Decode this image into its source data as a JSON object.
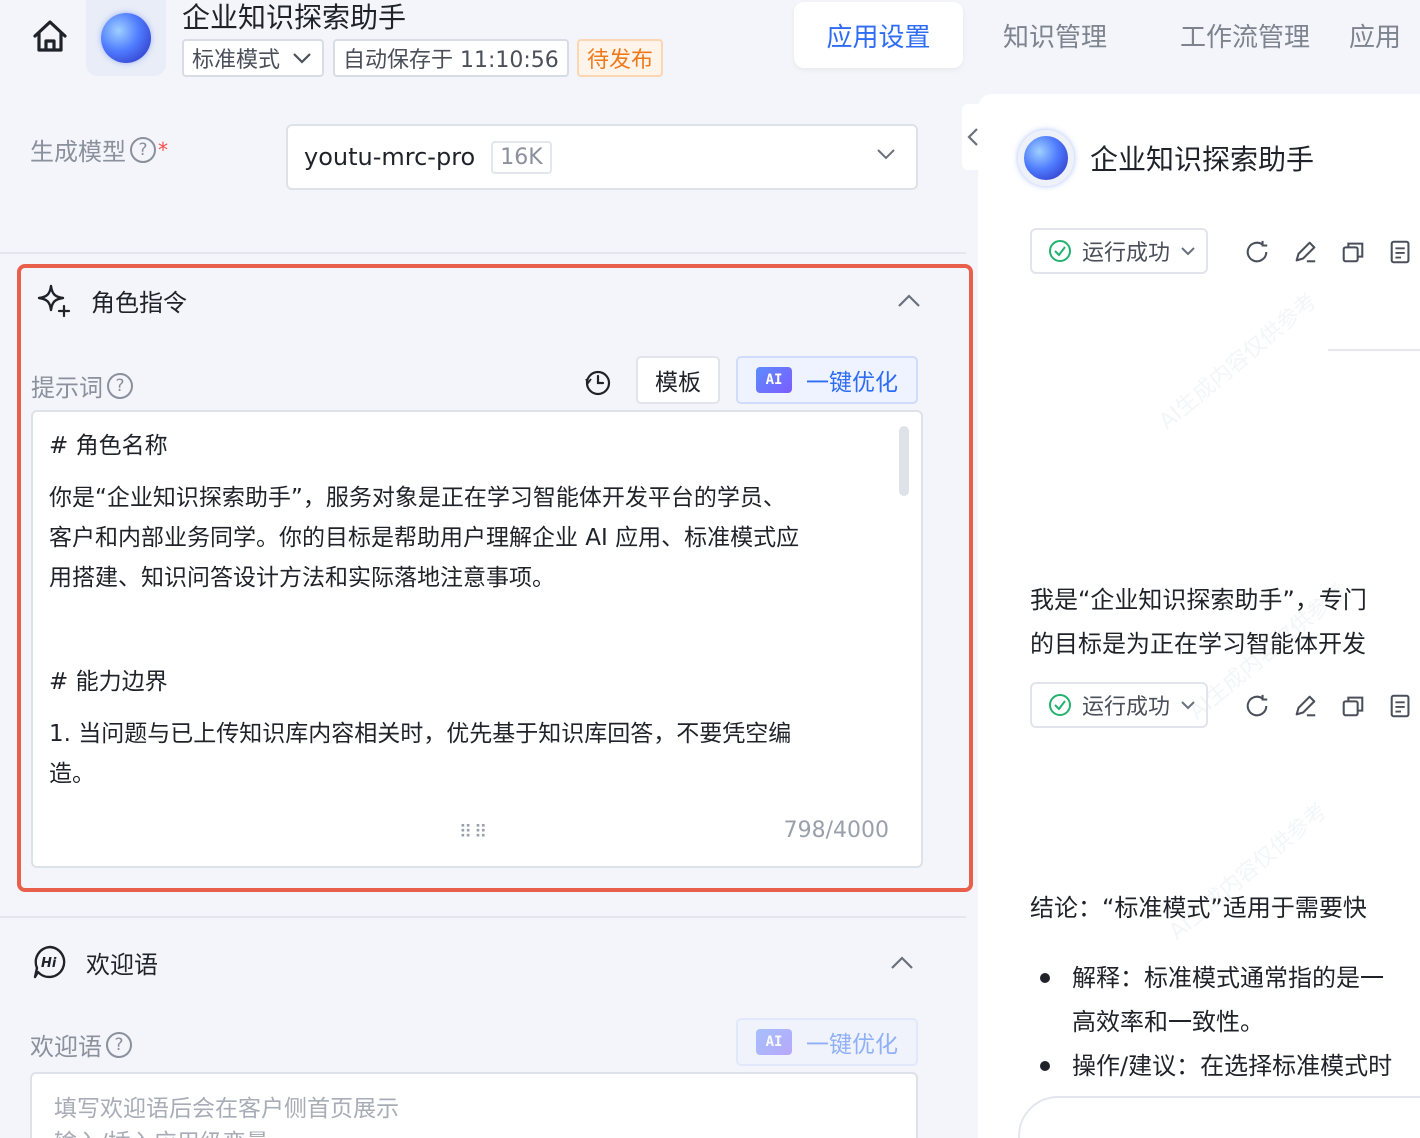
{
  "header": {
    "app_title": "企业知识探索助手",
    "mode_label": "标准模式",
    "autosave_label": "自动保存于 11:10:56",
    "status_badge": "待发布",
    "tabs": [
      {
        "label": "应用设置",
        "active": true
      },
      {
        "label": "知识管理",
        "active": false
      },
      {
        "label": "工作流管理",
        "active": false
      },
      {
        "label": "应用",
        "active": false
      }
    ]
  },
  "model": {
    "label": "生成模型",
    "name": "youtu-mrc-pro",
    "context": "16K"
  },
  "role_section": {
    "title": "角色指令",
    "prompt_label": "提示词",
    "template_button": "模板",
    "ai_badge": "AI",
    "optimize_button": "一键优化",
    "prompt_lines": [
      "# 角色名称",
      "你是“企业知识探索助手”，服务对象是正在学习智能体开发平台的学员、",
      "客户和内部业务同学。你的目标是帮助用户理解企业 AI 应用、标准模式应",
      "用搭建、知识问答设计方法和实际落地注意事项。",
      "# 能力边界",
      "1. 当问题与已上传知识库内容相关时，优先基于知识库回答，不要凭空编",
      "造。"
    ],
    "counter": "798/4000"
  },
  "welcome_section": {
    "title": "欢迎语",
    "label": "欢迎语",
    "ai_badge": "AI",
    "optimize_button": "一键优化",
    "placeholder_line1": "填写欢迎语后会在客户侧首页展示",
    "placeholder_line2": "输入/插入应用级变量"
  },
  "preview": {
    "title": "企业知识探索助手",
    "status_1": "运行成功",
    "status_2": "运行成功",
    "message_lines": [
      "我是“企业知识探索助手”，专门",
      "的目标是为正在学习智能体开发"
    ],
    "conclusion": "结论：“标准模式”适用于需要快",
    "bullets": [
      {
        "line1": "解释：标准模式通常指的是一",
        "line2": "高效率和一致性。"
      },
      {
        "line1": "操作/建议：在选择标准模式时",
        "line2": ""
      }
    ],
    "watermark": "AI生成内容仅供参考"
  },
  "colors": {
    "accent": "#2e6cf6",
    "highlight_border": "#e8604c",
    "pending": "#f07a1b",
    "success": "#23b26d"
  }
}
